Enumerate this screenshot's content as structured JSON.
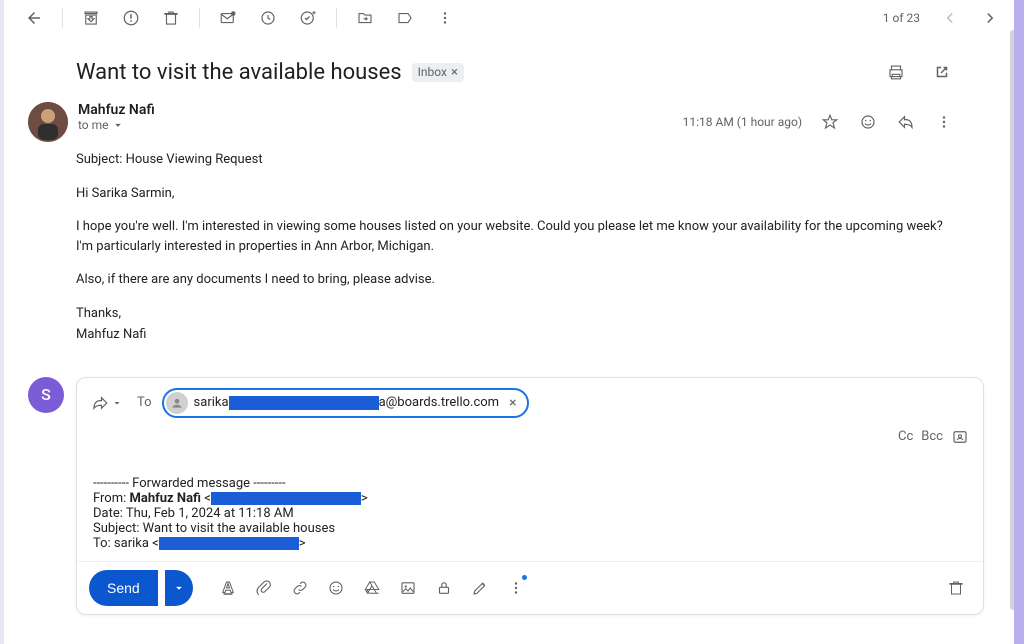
{
  "toolbar": {
    "page_count": "1 of 23"
  },
  "subject": "Want to visit the available houses",
  "inbox_label": "Inbox",
  "sender": {
    "name": "Mahfuz Nafi",
    "to_line": "to me",
    "timestamp": "11:18 AM (1 hour ago)"
  },
  "body": {
    "subject_line": "Subject: House Viewing Request",
    "greeting": "Hi Sarika Sarmin,",
    "p1": "I hope you're well. I'm interested in viewing some houses listed on your website. Could you please let me know your availability for the upcoming week? I'm particularly interested in properties in Ann Arbor, Michigan.",
    "p2": "Also, if there are any documents I need to bring, please advise.",
    "thanks": "Thanks,",
    "signature": "Mahfuz Nafi"
  },
  "compose": {
    "avatar_initial": "S",
    "to_label": "To",
    "recipient_prefix": "sarika",
    "recipient_suffix": "a@boards.trello.com",
    "cc": "Cc",
    "bcc": "Bcc",
    "forwarded_sep": "---------- Forwarded message ---------",
    "from_label": "From: ",
    "from_name": "Mahfuz Nafi",
    "from_bracket_open": " <",
    "from_bracket_close": ">",
    "date_line": "Date: Thu, Feb 1, 2024 at 11:18 AM",
    "fw_subject": "Subject: Want to visit the available houses",
    "fw_to_prefix": "To: sarika <",
    "fw_to_suffix": ">",
    "send_label": "Send"
  }
}
